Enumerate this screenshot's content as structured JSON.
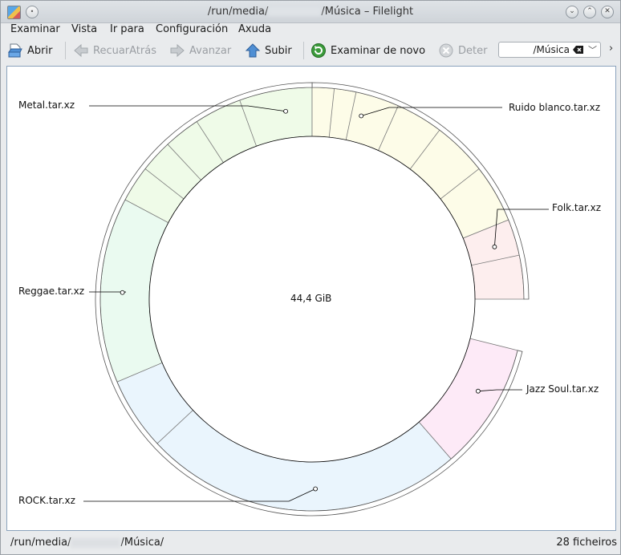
{
  "window": {
    "title_prefix": "/run/media/",
    "title_suffix": "/Música – Filelight"
  },
  "menu": [
    "Examinar",
    "Vista",
    "Ir para",
    "Configuración",
    "Axuda"
  ],
  "toolbar": {
    "open": "Abrir",
    "back": "RecuarAtrás",
    "forward": "Avanzar",
    "up": "Subir",
    "rescan": "Examinar de novo",
    "stop": "Deter",
    "path_value": "/Música"
  },
  "chart": {
    "center_label": "44,4 GiB",
    "segments": [
      {
        "label": "Metal.tar.xz",
        "color": "#effbe8"
      },
      {
        "label": "Ruido blanco.tar.xz",
        "color": "#fdfce8"
      },
      {
        "label": "Folk.tar.xz",
        "color": "#fdeeee"
      },
      {
        "label": "Jazz Soul.tar.xz",
        "color": "#fdeaf7"
      },
      {
        "label": "ROCK.tar.xz",
        "color": "#eaf5fd"
      },
      {
        "label": "Reggae.tar.xz",
        "color": "#eafaf0"
      }
    ]
  },
  "status": {
    "path_prefix": "/run/media/",
    "path_suffix": "/Música/",
    "file_count": "28 ficheiros"
  }
}
